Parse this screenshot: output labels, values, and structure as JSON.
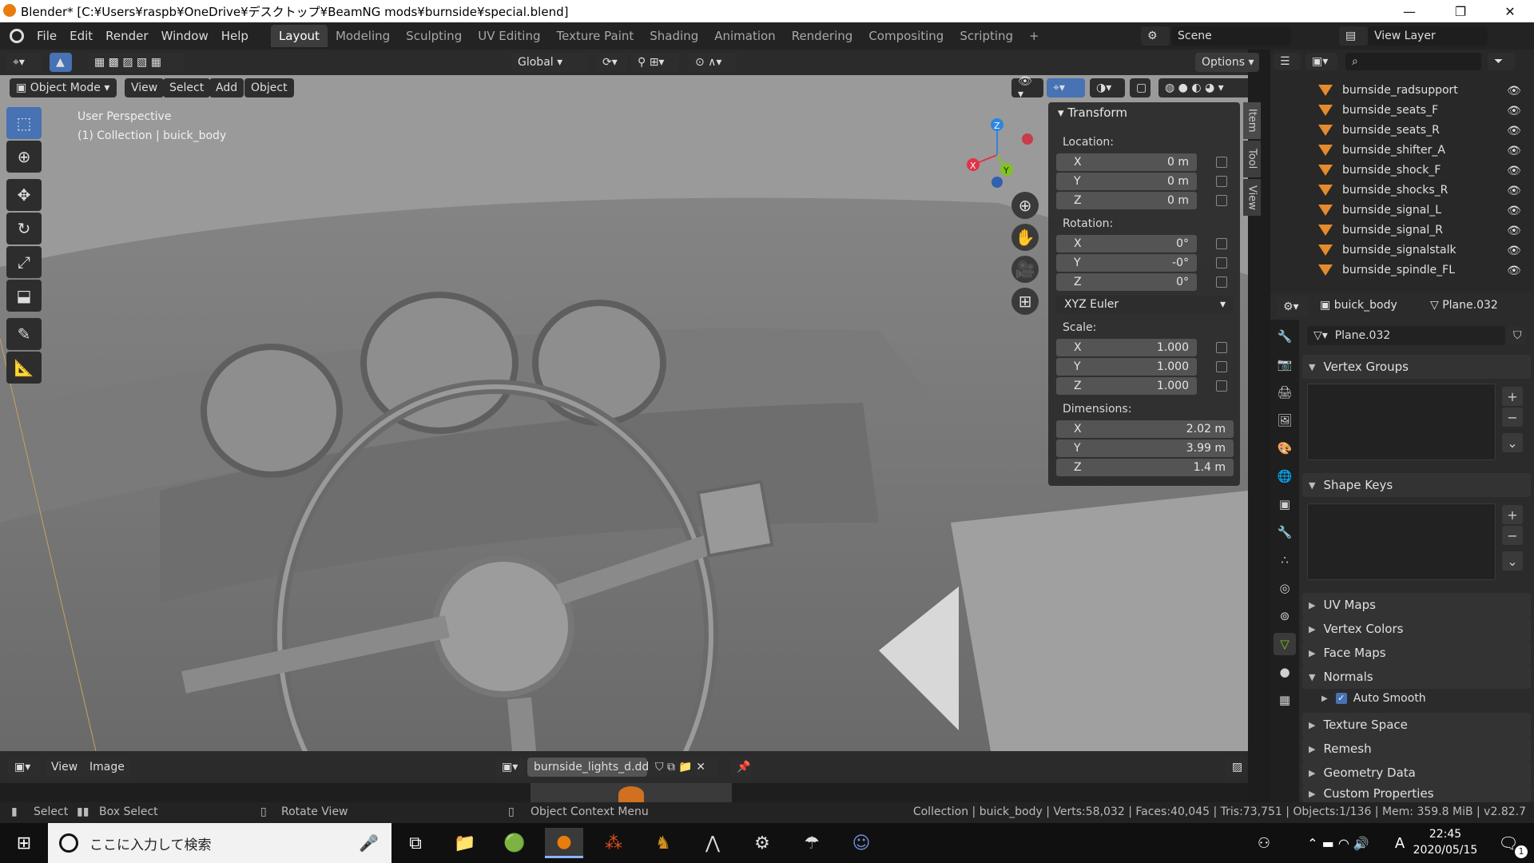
{
  "window": {
    "title": "Blender* [C:¥Users¥raspb¥OneDrive¥デスクトップ¥BeamNG mods¥burnside¥special.blend]",
    "minimize": "—",
    "maximize": "❐",
    "close": "✕"
  },
  "menubar": {
    "items": [
      "File",
      "Edit",
      "Render",
      "Window",
      "Help"
    ],
    "workspaces": [
      "Layout",
      "Modeling",
      "Sculpting",
      "UV Editing",
      "Texture Paint",
      "Shading",
      "Animation",
      "Rendering",
      "Compositing",
      "Scripting"
    ],
    "add_tab": "+",
    "scene_label": "Scene",
    "view_layer_label": "View Layer"
  },
  "viewport": {
    "orientation": "Global",
    "options": "Options",
    "mode": "Object Mode",
    "menus": [
      "View",
      "Select",
      "Add",
      "Object"
    ],
    "perspective": "User Perspective",
    "collection_info": "(1) Collection | buick_body"
  },
  "npanel": {
    "header": "Transform",
    "location_label": "Location:",
    "location": {
      "x": "0 m",
      "y": "0 m",
      "z": "0 m"
    },
    "rotation_label": "Rotation:",
    "rotation": {
      "x": "0°",
      "y": "-0°",
      "z": "0°"
    },
    "rotation_mode": "XYZ Euler",
    "scale_label": "Scale:",
    "scale": {
      "x": "1.000",
      "y": "1.000",
      "z": "1.000"
    },
    "dimensions_label": "Dimensions:",
    "dimensions": {
      "x": "2.02 m",
      "y": "3.99 m",
      "z": "1.4 m"
    },
    "axes": {
      "x": "X",
      "y": "Y",
      "z": "Z"
    },
    "tabs": [
      "Item",
      "Tool",
      "View"
    ]
  },
  "outliner": {
    "items": [
      "burnside_radsupport",
      "burnside_seats_F",
      "burnside_seats_R",
      "burnside_shifter_A",
      "burnside_shock_F",
      "burnside_shocks_R",
      "burnside_signal_L",
      "burnside_signal_R",
      "burnside_signalstalk",
      "burnside_spindle_FL"
    ]
  },
  "properties": {
    "object_name": "buick_body",
    "mesh_name": "Plane.032",
    "datablock": "Plane.032",
    "sections": [
      "Vertex Groups",
      "Shape Keys",
      "UV Maps",
      "Vertex Colors",
      "Face Maps",
      "Normals",
      "Texture Space",
      "Remesh",
      "Geometry Data",
      "Custom Properties"
    ],
    "auto_smooth": "Auto Smooth"
  },
  "image_editor": {
    "menus": [
      "View",
      "Image"
    ],
    "image_name": "burnside_lights_d.dds"
  },
  "statusbar": {
    "select": "Select",
    "box_select": "Box Select",
    "rotate_view": "Rotate View",
    "context_menu": "Object Context Menu",
    "stats": "Collection | buick_body | Verts:58,032 | Faces:40,045 | Tris:73,751 | Objects:1/136 | Mem: 359.8 MiB | v2.82.7"
  },
  "taskbar": {
    "search_placeholder": "ここに入力して検索",
    "time": "22:45",
    "date": "2020/05/15",
    "ime": "A",
    "notifications": "1"
  },
  "colors": {
    "accent_blue": "#4772b3",
    "outliner_mesh": "#e68a2e",
    "axis_x": "#e0344a",
    "axis_y": "#7fc31f",
    "axis_z": "#2d86e0"
  }
}
